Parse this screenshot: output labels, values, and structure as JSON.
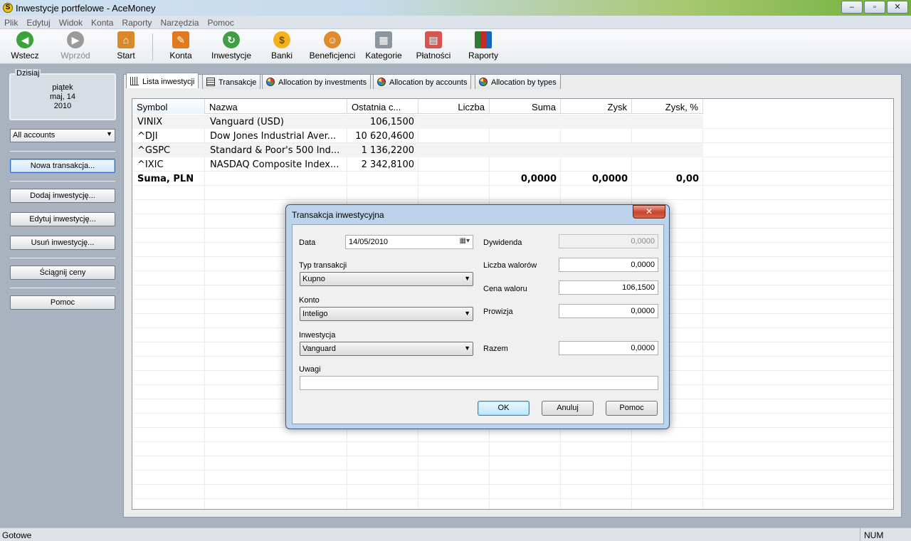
{
  "window": {
    "title": "Inwestycje portfelowe - AceMoney",
    "minimize": "–",
    "maximize": "▫",
    "close": "✕"
  },
  "menu": [
    "Plik",
    "Edytuj",
    "Widok",
    "Konta",
    "Raporty",
    "Narzędzia",
    "Pomoc"
  ],
  "toolbar": {
    "back": "Wstecz",
    "forward": "Wprzód",
    "start": "Start",
    "accounts": "Konta",
    "investments": "Inwestycje",
    "banks": "Banki",
    "payees": "Beneficjenci",
    "categories": "Kategorie",
    "payments": "Płatności",
    "reports": "Raporty"
  },
  "sidebar": {
    "today_caption": "Dzisiaj",
    "day": "piątek",
    "date": "maj, 14",
    "year": "2010",
    "account_filter": "All accounts",
    "buttons": {
      "new_transaction": "Nowa transakcja...",
      "add_investment": "Dodaj inwestycję...",
      "edit_investment": "Edytuj inwestycję...",
      "delete_investment": "Usuń inwestycję...",
      "download_prices": "Ściągnij ceny",
      "help": "Pomoc"
    }
  },
  "tabs": [
    {
      "label": "Lista inwestycji",
      "icon": "list-icon"
    },
    {
      "label": "Transakcje",
      "icon": "table-icon"
    },
    {
      "label": "Allocation by investments",
      "icon": "pie-chart-icon"
    },
    {
      "label": "Allocation by accounts",
      "icon": "pie-chart-icon"
    },
    {
      "label": "Allocation by types",
      "icon": "pie-chart-icon"
    }
  ],
  "table": {
    "columns": [
      "Symbol",
      "Nazwa",
      "Ostatnia c...",
      "Liczba",
      "Suma",
      "Zysk",
      "Zysk, %"
    ],
    "rows": [
      [
        "VINIX",
        "Vanguard (USD)",
        "106,1500",
        "",
        "",
        "",
        ""
      ],
      [
        "^DJI",
        "Dow Jones Industrial Aver...",
        "10 620,4600",
        "",
        "",
        "",
        ""
      ],
      [
        "^GSPC",
        "Standard & Poor's 500 Ind...",
        "1 136,2200",
        "",
        "",
        "",
        ""
      ],
      [
        "^IXIC",
        "NASDAQ Composite Index...",
        "2 342,8100",
        "",
        "",
        "",
        ""
      ]
    ],
    "total": [
      "Suma, PLN",
      "",
      "",
      "",
      "0,0000",
      "0,0000",
      "0,00"
    ]
  },
  "status": {
    "text": "Gotowe",
    "num": "NUM"
  },
  "dialog": {
    "title": "Transakcja inwestycyjna",
    "close": "✕",
    "date_label": "Data",
    "date_value": "14/05/2010",
    "type_label": "Typ transakcji",
    "type_value": "Kupno",
    "account_label": "Konto",
    "account_value": "Inteligo",
    "investment_label": "Inwestycja",
    "investment_value": "Vanguard",
    "notes_label": "Uwagi",
    "notes_value": "",
    "dividend_label": "Dywidenda",
    "dividend_value": "0,0000",
    "shares_label": "Liczba walorów",
    "shares_value": "0,0000",
    "price_label": "Cena waloru",
    "price_value": "106,1500",
    "commission_label": "Prowizja",
    "commission_value": "0,0000",
    "total_label": "Razem",
    "total_value": "0,0000",
    "ok": "OK",
    "cancel": "Anuluj",
    "help": "Pomoc"
  }
}
